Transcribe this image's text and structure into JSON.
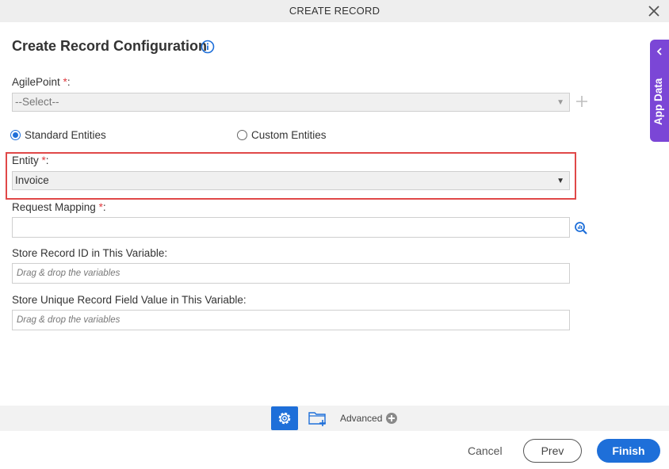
{
  "window": {
    "title": "CREATE RECORD"
  },
  "heading": "Create Record Configuration",
  "agilepoint": {
    "label": "AgilePoint ",
    "required": "*",
    "colon": ":",
    "value": "--Select--"
  },
  "entity_type": {
    "standard_label": "Standard Entities",
    "custom_label": "Custom Entities",
    "selected": "standard"
  },
  "entity": {
    "label": "Entity ",
    "required": "*",
    "colon": ":",
    "value": "Invoice"
  },
  "request_mapping": {
    "label": "Request Mapping ",
    "required": "*",
    "colon": ":",
    "value": ""
  },
  "store_record_id": {
    "label": "Store Record ID in This Variable:",
    "placeholder": "Drag & drop the variables"
  },
  "store_unique": {
    "label": "Store Unique Record Field Value in This Variable:",
    "placeholder": "Drag & drop the variables"
  },
  "side_panel": {
    "label": "App Data"
  },
  "toolbar": {
    "advanced_label": "Advanced"
  },
  "footer": {
    "cancel": "Cancel",
    "prev": "Prev",
    "finish": "Finish"
  },
  "colors": {
    "accent": "#1e6fd9",
    "app_data": "#7b46d6",
    "highlight": "#e04848",
    "required": "#e0393e"
  }
}
